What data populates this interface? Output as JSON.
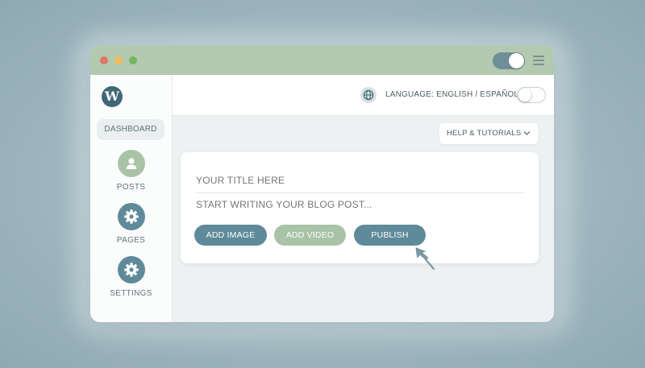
{
  "sidebar": {
    "logo_icon": "wordpress-logo-icon",
    "logo_text": "W",
    "items": [
      {
        "label": "DASHBOARD",
        "icon": null
      },
      {
        "label": "POSTS",
        "icon": "user-icon"
      },
      {
        "label": "PAGES",
        "icon": "gear-icon"
      },
      {
        "label": "SETTINGS",
        "icon": "gear-icon"
      }
    ]
  },
  "titlebar": {
    "toggle_state": "on",
    "menu_icon": "hamburger-icon"
  },
  "header": {
    "language_icon": "globe-icon",
    "language_label": "LANGUAGE: ENGLISH / ESPAÑOL",
    "language_toggle_state": "off"
  },
  "help": {
    "label": "HELP & TUTORIALS",
    "icon": "chevron-down-icon"
  },
  "editor": {
    "title_placeholder": "YOUR TITLE HERE",
    "body_placeholder": "START WRITING YOUR BLOG POST...",
    "buttons": {
      "add_image": "ADD IMAGE",
      "add_video": "ADD VIDEO",
      "publish": "PUBLISH"
    }
  },
  "colors": {
    "titlebar": "#b3c9b0",
    "accent_blue": "#5f8a99",
    "accent_green": "#a9c3a6",
    "logo": "#3f6777"
  }
}
